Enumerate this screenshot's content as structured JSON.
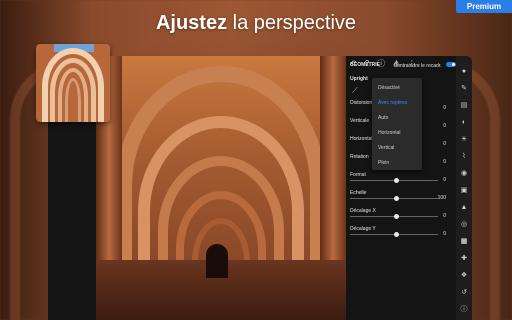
{
  "headline": {
    "bold": "Ajustez",
    "rest": " la perspective"
  },
  "premium_badge": "Premium",
  "panel": {
    "title": "GEOMETRIE",
    "constrain_label": "Contraindre le recadr.",
    "constrain_on": true,
    "upright_label": "Upright",
    "rows": [
      {
        "label": "Distorsion",
        "value": "0"
      },
      {
        "label": "Verticale",
        "value": "0"
      },
      {
        "label": "Horizontal",
        "value": "0"
      },
      {
        "label": "Rotation",
        "value": "0"
      },
      {
        "label": "Format",
        "value": "0"
      },
      {
        "label": "Echelle",
        "value": "100"
      },
      {
        "label": "Décalage X",
        "value": "0"
      },
      {
        "label": "Décalage Y",
        "value": "0"
      }
    ],
    "dropdown": [
      {
        "label": "Désactivé",
        "selected": false
      },
      {
        "label": "Avec repères",
        "selected": true
      },
      {
        "label": "Auto",
        "selected": false
      },
      {
        "label": "Horizontal",
        "selected": false
      },
      {
        "label": "Vertical",
        "selected": false
      },
      {
        "label": "Plein",
        "selected": false
      }
    ]
  },
  "sidebar_icons": [
    "settings-icon",
    "brush-icon",
    "gradient-icon",
    "stamp-icon",
    "light-icon",
    "temperature-icon",
    "color-icon",
    "effects-icon",
    "detail-icon",
    "optics-icon",
    "geometry-icon",
    "heal-icon",
    "versions-icon",
    "history-icon",
    "info-icon"
  ],
  "accent_color": "#2a7ee6"
}
